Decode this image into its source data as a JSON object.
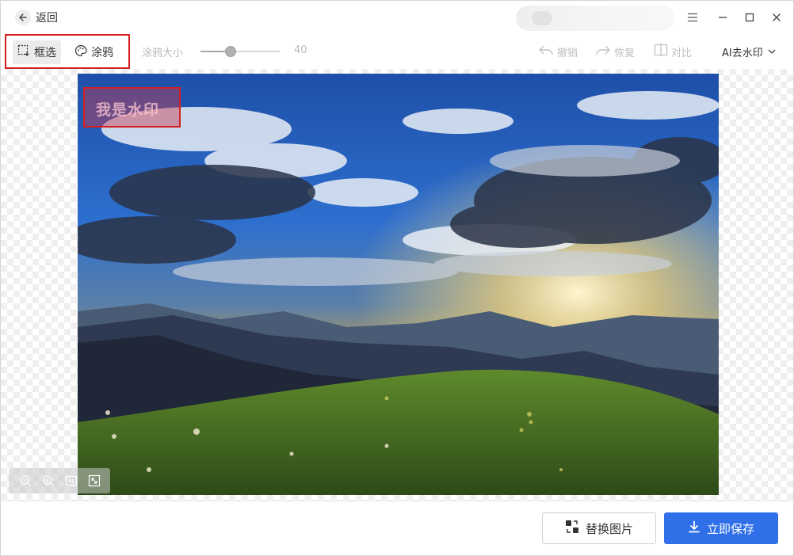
{
  "header": {
    "back_label": "返回",
    "back_icon": "arrow-left-icon"
  },
  "toolbar": {
    "modes": [
      {
        "label": "框选",
        "icon": "box-select-icon",
        "active": true
      },
      {
        "label": "涂鸦",
        "icon": "palette-icon",
        "active": false
      }
    ],
    "brush_size_label": "涂鸦大小",
    "brush_size_value": "40",
    "brush_size_level": 0.38,
    "undo_label": "撤销",
    "redo_label": "恢复",
    "compare_label": "对比",
    "ai_select_label": "AI去水印"
  },
  "canvas": {
    "watermark_text": "我是水印"
  },
  "footer": {
    "replace_label": "替换图片",
    "save_label": "立即保存"
  },
  "colors": {
    "accent": "#2f6fe8",
    "highlight": "#d42020"
  }
}
